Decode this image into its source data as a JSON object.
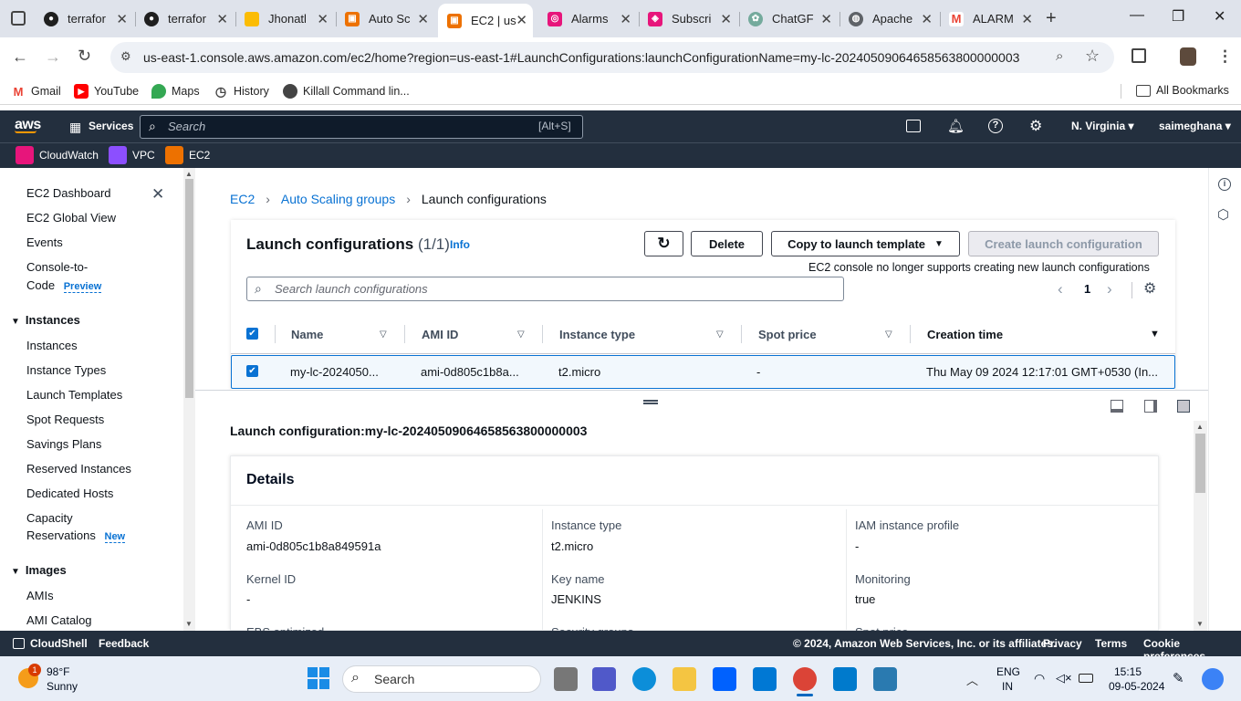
{
  "browser": {
    "tabs": [
      {
        "label": "terrafor",
        "icon": "github-icon"
      },
      {
        "label": "terrafor",
        "icon": "github-icon"
      },
      {
        "label": "Jhonatl",
        "icon": "bookmark-icon"
      },
      {
        "label": "Auto Sc",
        "icon": "aws-ec2-icon"
      },
      {
        "label": "EC2 | us",
        "icon": "aws-ec2-icon"
      },
      {
        "label": "Alarms",
        "icon": "aws-cloudwatch-icon"
      },
      {
        "label": "Subscri",
        "icon": "aws-sns-icon"
      },
      {
        "label": "ChatGF",
        "icon": "chatgpt-icon"
      },
      {
        "label": "Apache",
        "icon": "globe-icon"
      },
      {
        "label": "ALARM",
        "icon": "gmail-icon"
      }
    ],
    "url": "us-east-1.console.aws.amazon.com/ec2/home?region=us-east-1#LaunchConfigurations:launchConfigurationName=my-lc-20240509064658563800000003",
    "bookmarks": [
      "Gmail",
      "YouTube",
      "Maps",
      "History",
      "Killall Command lin..."
    ],
    "all_bookmarks": "All Bookmarks"
  },
  "aws": {
    "logo": "aws",
    "services": "Services",
    "search_placeholder": "Search",
    "search_shortcut": "[Alt+S]",
    "region": "N. Virginia",
    "user": "saimeghana",
    "favorites": [
      "CloudWatch",
      "VPC",
      "EC2"
    ]
  },
  "sidebar": {
    "items_top": [
      "EC2 Dashboard",
      "EC2 Global View",
      "Events"
    ],
    "console_to_code": "Console-to-",
    "console_to_code_2": "Code",
    "preview_badge": "Preview",
    "section_instances": "Instances",
    "instances_items": [
      "Instances",
      "Instance Types",
      "Launch Templates",
      "Spot Requests",
      "Savings Plans",
      "Reserved Instances",
      "Dedicated Hosts"
    ],
    "capacity": "Capacity",
    "reservations": "Reservations",
    "new_badge": "New",
    "section_images": "Images",
    "images_items": [
      "AMIs",
      "AMI Catalog"
    ]
  },
  "breadcrumb": [
    "EC2",
    "Auto Scaling groups",
    "Launch configurations"
  ],
  "panel": {
    "title": "Launch configurations",
    "count": "(1/1)",
    "info": "Info",
    "delete": "Delete",
    "copy": "Copy to launch template",
    "create": "Create launch configuration",
    "notice": "EC2 console no longer supports creating new launch configurations",
    "search_placeholder": "Search launch configurations",
    "page": "1",
    "columns": [
      "Name",
      "AMI ID",
      "Instance type",
      "Spot price",
      "Creation time"
    ],
    "row": {
      "name": "my-lc-2024050...",
      "ami": "ami-0d805c1b8a...",
      "type": "t2.micro",
      "spot": "-",
      "created": "Thu May 09 2024 12:17:01 GMT+0530 (In..."
    }
  },
  "details": {
    "header": "Launch configuration:my-lc-20240509064658563800000003",
    "card_title": "Details",
    "fields": [
      {
        "label": "AMI ID",
        "value": "ami-0d805c1b8a849591a"
      },
      {
        "label": "Instance type",
        "value": "t2.micro"
      },
      {
        "label": "IAM instance profile",
        "value": "-"
      },
      {
        "label": "Kernel ID",
        "value": "-"
      },
      {
        "label": "Key name",
        "value": "JENKINS"
      },
      {
        "label": "Monitoring",
        "value": "true"
      }
    ],
    "cut_labels": [
      "EBS optimized",
      "Security groups",
      "Spot price"
    ]
  },
  "footer": {
    "cloudshell": "CloudShell",
    "feedback": "Feedback",
    "copyright": "© 2024, Amazon Web Services, Inc. or its affiliates.",
    "privacy": "Privacy",
    "terms": "Terms",
    "cookies": "Cookie preferences"
  },
  "taskbar": {
    "weather_temp": "98°F",
    "weather_desc": "Sunny",
    "weather_badge": "1",
    "search": "Search",
    "lang1": "ENG",
    "lang2": "IN",
    "time": "15:15",
    "date": "09-05-2024"
  },
  "colors": {
    "aws_dark": "#232f3e",
    "link": "#0972d3",
    "aws_orange": "#ff9900",
    "selected_row": "#f2f8fd"
  }
}
